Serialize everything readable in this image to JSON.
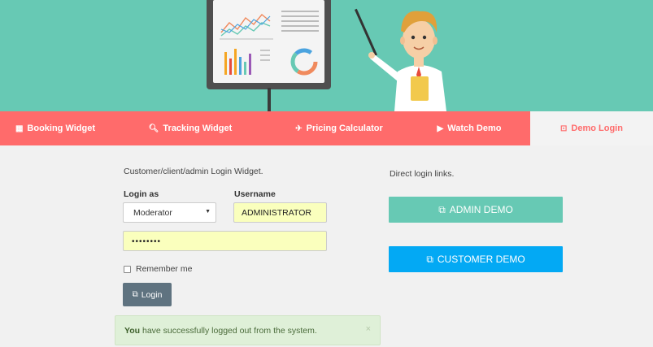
{
  "nav": {
    "tabs": [
      {
        "label": "Booking Widget",
        "icon": "calendar-icon"
      },
      {
        "label": "Tracking Widget",
        "icon": "search-icon"
      },
      {
        "label": "Pricing Calculator",
        "icon": "plane-icon"
      },
      {
        "label": "Watch Demo",
        "icon": "video-icon"
      },
      {
        "label": "Demo Login",
        "icon": "login-icon",
        "active": true
      }
    ]
  },
  "login": {
    "intro": "Customer/client/admin Login Widget.",
    "login_as_label": "Login as",
    "login_as_value": "Moderator",
    "username_label": "Username",
    "username_value": "ADMINISTRATOR",
    "password_value": "••••••••",
    "remember_label": "Remember me",
    "login_button": "Login",
    "alert_bold": "You",
    "alert_text": " have successfully logged out from the system.",
    "alert_close": "×"
  },
  "direct": {
    "label": "Direct login links.",
    "admin_button": "ADMIN DEMO",
    "customer_button": "CUSTOMER DEMO"
  },
  "colors": {
    "hero": "#67c9b4",
    "nav": "#ff6b6b",
    "admin": "#67c9b4",
    "customer": "#03a9f4"
  }
}
